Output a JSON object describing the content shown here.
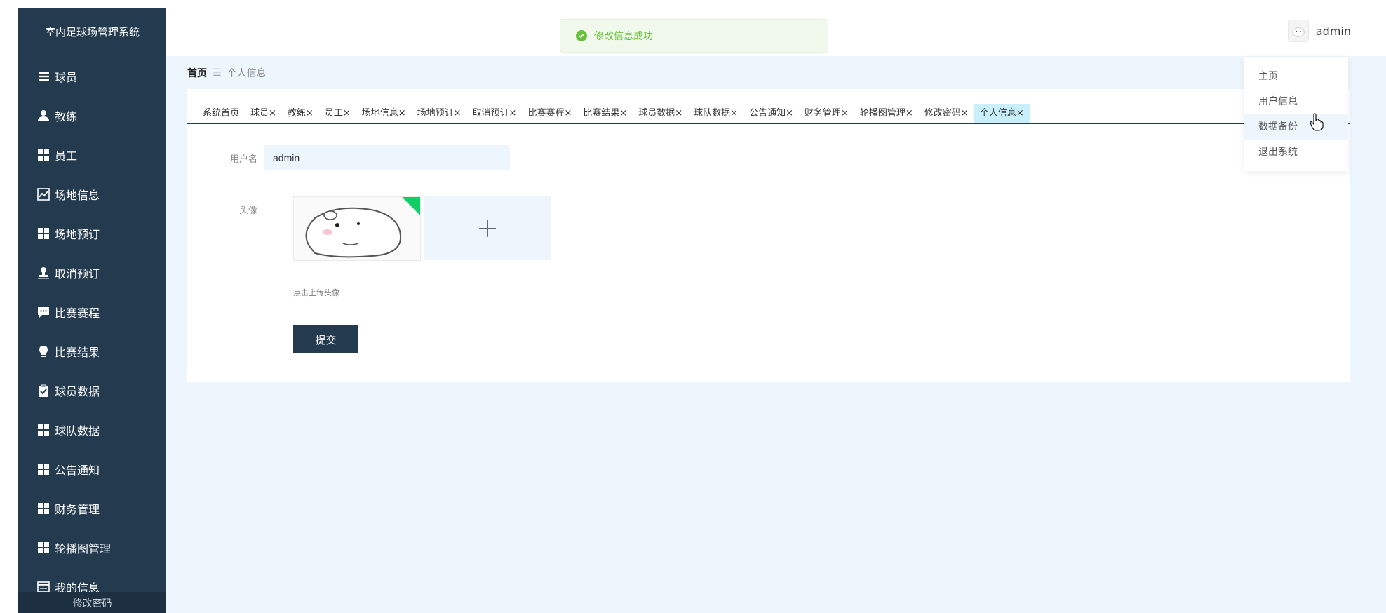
{
  "app": {
    "title": "室内足球场管理系统"
  },
  "sidebar": {
    "items": [
      {
        "label": "球员",
        "icon": "list-icon"
      },
      {
        "label": "教练",
        "icon": "person-icon"
      },
      {
        "label": "员工",
        "icon": "grid-icon"
      },
      {
        "label": "场地信息",
        "icon": "chart-icon"
      },
      {
        "label": "场地预订",
        "icon": "grid-icon"
      },
      {
        "label": "取消预订",
        "icon": "stamp-icon"
      },
      {
        "label": "比赛赛程",
        "icon": "comment-icon"
      },
      {
        "label": "比赛结果",
        "icon": "bulb-icon"
      },
      {
        "label": "球员数据",
        "icon": "clipboard-icon"
      },
      {
        "label": "球队数据",
        "icon": "grid-icon"
      },
      {
        "label": "公告通知",
        "icon": "grid-icon"
      },
      {
        "label": "财务管理",
        "icon": "grid-icon"
      },
      {
        "label": "轮播图管理",
        "icon": "grid-icon"
      },
      {
        "label": "我的信息",
        "icon": "card-icon"
      }
    ],
    "sub_item": "修改密码"
  },
  "header": {
    "username": "admin",
    "avatar_icon": "avatar-icon"
  },
  "toast": {
    "message": "修改信息成功",
    "color": "#67c23a"
  },
  "breadcrumb": {
    "home": "首页",
    "separator": "☰",
    "current": "个人信息"
  },
  "tabs": [
    {
      "label": "系统首页",
      "closable": false
    },
    {
      "label": "球员×",
      "closable": true
    },
    {
      "label": "教练×",
      "closable": true
    },
    {
      "label": "员工×",
      "closable": true
    },
    {
      "label": "场地信息×",
      "closable": true
    },
    {
      "label": "场地预订×",
      "closable": true
    },
    {
      "label": "取消预订×",
      "closable": true
    },
    {
      "label": "比赛赛程×",
      "closable": true
    },
    {
      "label": "比赛结果×",
      "closable": true
    },
    {
      "label": "球员数据×",
      "closable": true
    },
    {
      "label": "球队数据×",
      "closable": true
    },
    {
      "label": "公告通知×",
      "closable": true
    },
    {
      "label": "财务管理×",
      "closable": true
    },
    {
      "label": "轮播图管理×",
      "closable": true
    },
    {
      "label": "修改密码×",
      "closable": true
    },
    {
      "label": "个人信息×",
      "closable": true,
      "active": true
    }
  ],
  "form": {
    "username_label": "用户名",
    "username_value": "admin",
    "avatar_label": "头像",
    "upload_tip": "点击上传头像",
    "plus": "+",
    "submit_label": "提交"
  },
  "dropdown": {
    "items": [
      "主页",
      "用户信息",
      "数据备份",
      "退出系统"
    ],
    "hovered": "数据备份"
  },
  "colors": {
    "sidebar": "#233a4f",
    "main_bg": "#eef6fd",
    "active_tab": "#c9f0fa",
    "accent_green": "#13ce66"
  }
}
